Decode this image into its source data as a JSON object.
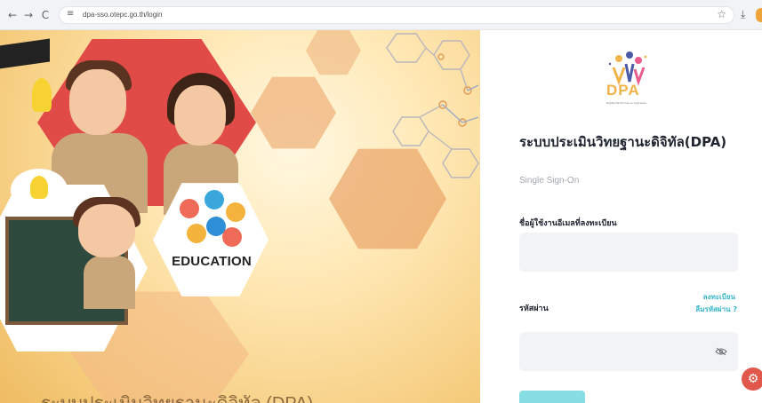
{
  "browser": {
    "url": "dpa-sso.otepc.go.th/login",
    "back_icon": "←",
    "forward_icon": "→",
    "reload_icon": "C",
    "site_info_icon": "≡",
    "bookmark_icon": "☆",
    "download_icon": "⤓"
  },
  "hero": {
    "education_label": "EDUCATION",
    "title": "ระบบประเมินวิทยฐานะดิจิทัล (DPA)"
  },
  "login": {
    "logo_text": "DPA",
    "logo_subtext": "Digital Performance Appraisal",
    "title": "ระบบประเมินวิทยฐานะดิจิทัล(DPA)",
    "subtitle": "Single Sign-On",
    "username_label": "ชื่อผู้ใช้งานอีเมลที่ลงทะเบียน",
    "username_value": "",
    "password_label": "รหัสผ่าน",
    "password_value": "",
    "register_link": "ลงทะเบียน",
    "forgot_link": "ลืมรหัสผ่าน ?",
    "accent_color": "#38b6c9",
    "button_color": "#86dde4",
    "fab_icon": "⚙"
  }
}
